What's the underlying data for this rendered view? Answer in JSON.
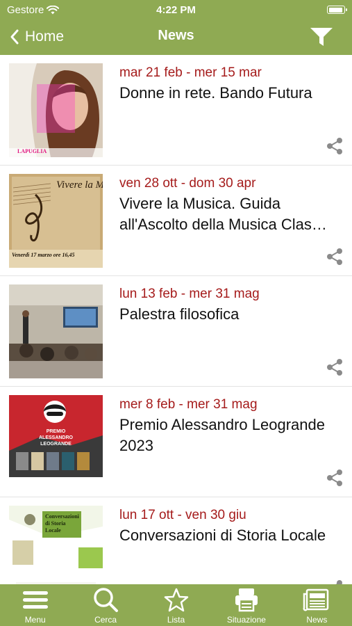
{
  "status": {
    "carrier": "Gestore",
    "time": "4:22 PM"
  },
  "nav": {
    "back_label": "Home",
    "title": "News"
  },
  "items": [
    {
      "date": "mar 21 feb - mer 15 mar",
      "title": "Donne in rete. Bando Futura",
      "thumb_caption": "LAPUGLIA"
    },
    {
      "date": "ven 28 ott - dom 30 apr",
      "title": "Vivere la Musica. Guida all'Ascolto della Musica Clas…",
      "thumb_caption": "Vivere la M",
      "thumb_sub": "Venerdì 17 marzo ore 16,45"
    },
    {
      "date": "lun 13 feb - mer 31 mag",
      "title": "Palestra filosofica"
    },
    {
      "date": "mer 8 feb - mer 31 mag",
      "title": "Premio Alessandro Leogrande 2023",
      "thumb_caption": "PREMIO ALESSANDRO LEOGRANDE"
    },
    {
      "date": "lun 17 ott - ven 30 giu",
      "title": "Conversazioni di Storia Locale",
      "thumb_caption": "Conversazioni di Storia Locale"
    }
  ],
  "tabs": [
    {
      "label": "Menu",
      "icon": "menu-icon"
    },
    {
      "label": "Cerca",
      "icon": "search-icon"
    },
    {
      "label": "Lista",
      "icon": "star-icon"
    },
    {
      "label": "Situazione",
      "icon": "situation-icon"
    },
    {
      "label": "News",
      "icon": "news-icon"
    }
  ],
  "colors": {
    "brand": "#8faa53",
    "date": "#a51b1b"
  }
}
